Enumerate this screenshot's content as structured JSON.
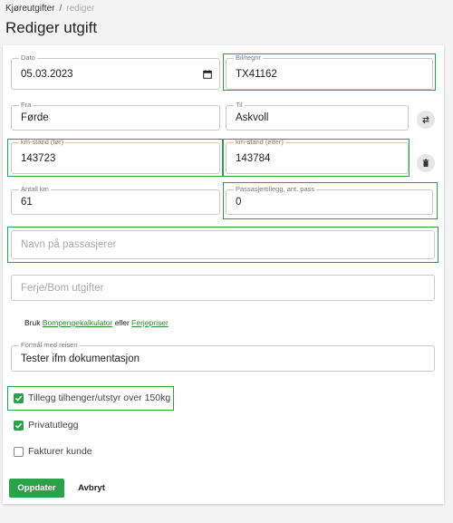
{
  "breadcrumb": {
    "parent": "Kjøreutgifter",
    "separator": "/",
    "current": "rediger"
  },
  "page_title": "Rediger utgift",
  "fields": {
    "dato": {
      "label": "Dato",
      "value": "05.03.2023"
    },
    "bil": {
      "label": "Bil/regnr",
      "value": "TX41162"
    },
    "fra": {
      "label": "Fra",
      "value": "Førde"
    },
    "til": {
      "label": "Til",
      "value": "Askvoll"
    },
    "km_for": {
      "label": "km-stand (før)",
      "value": "143723"
    },
    "km_etter": {
      "label": "km-stand (etter)",
      "value": "143784"
    },
    "antall_km": {
      "label": "Antall km",
      "value": "61"
    },
    "passasjer": {
      "label": "Passasjertillegg, ant. pass",
      "value": "0"
    },
    "navn_pass": {
      "placeholder": "Navn på passasjerer"
    },
    "ferje": {
      "placeholder": "Ferje/Bom utgifter"
    },
    "formal": {
      "label": "Formål med reisen",
      "value": "Tester ifm dokumentasjon"
    }
  },
  "help": {
    "prefix": "Bruk",
    "link1": "Bompengekalkulator",
    "middle": "eller",
    "link2": "Ferjepriser"
  },
  "checkboxes": [
    {
      "label": "Tillegg tilhenger/utstyr over 150kg",
      "checked": true
    },
    {
      "label": "Privatutlegg",
      "checked": true
    },
    {
      "label": "Fakturer kunde",
      "checked": false
    }
  ],
  "buttons": {
    "primary": "Oppdater",
    "cancel": "Avbryt"
  },
  "icons": {
    "calendar": "calendar-icon",
    "swap": "swap-icon",
    "delete": "trash-icon"
  },
  "colors": {
    "accent": "#2aa24a",
    "link": "#2d8a2d"
  }
}
